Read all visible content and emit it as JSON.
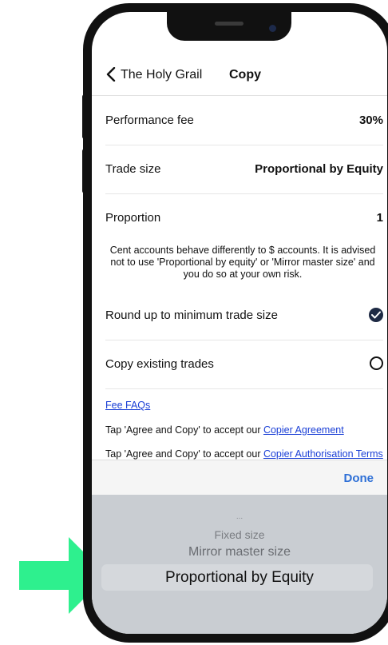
{
  "nav": {
    "back_label": "The Holy Grail",
    "title": "Copy"
  },
  "rows": {
    "performance_fee": {
      "label": "Performance fee",
      "value": "30%"
    },
    "trade_size": {
      "label": "Trade size",
      "value": "Proportional by Equity"
    },
    "proportion": {
      "label": "Proportion",
      "value": "1"
    }
  },
  "note": "Cent accounts behave differently to $ accounts. It is advised not to use 'Proportional by equity' or 'Mirror master size' and you do so at your own risk.",
  "options": {
    "round_up": {
      "label": "Round up to minimum trade size",
      "checked": true
    },
    "copy_existing": {
      "label": "Copy existing trades",
      "checked": false
    }
  },
  "links": {
    "fee_faqs": "Fee FAQs",
    "agreement_prefix": "Tap 'Agree and Copy' to accept our ",
    "agreement_link": "Copier Agreement",
    "authorisation_prefix": "Tap 'Agree and Copy' to accept our ",
    "authorisation_link": "Copier Authorisation Terms"
  },
  "toolbar": {
    "done_label": "Done"
  },
  "picker": {
    "dots": "...",
    "options": [
      "Fixed size",
      "Mirror master size",
      "Proportional by Equity"
    ],
    "selected": "Proportional by Equity"
  },
  "colors": {
    "arrow": "#2ef08e",
    "link": "#1a3fd6",
    "done": "#2d6fd6"
  },
  "icons": {
    "back": "chevron-left-icon",
    "checked": "checkmark-circle-icon",
    "unchecked": "empty-circle-icon",
    "pointer": "arrow-right-icon"
  }
}
